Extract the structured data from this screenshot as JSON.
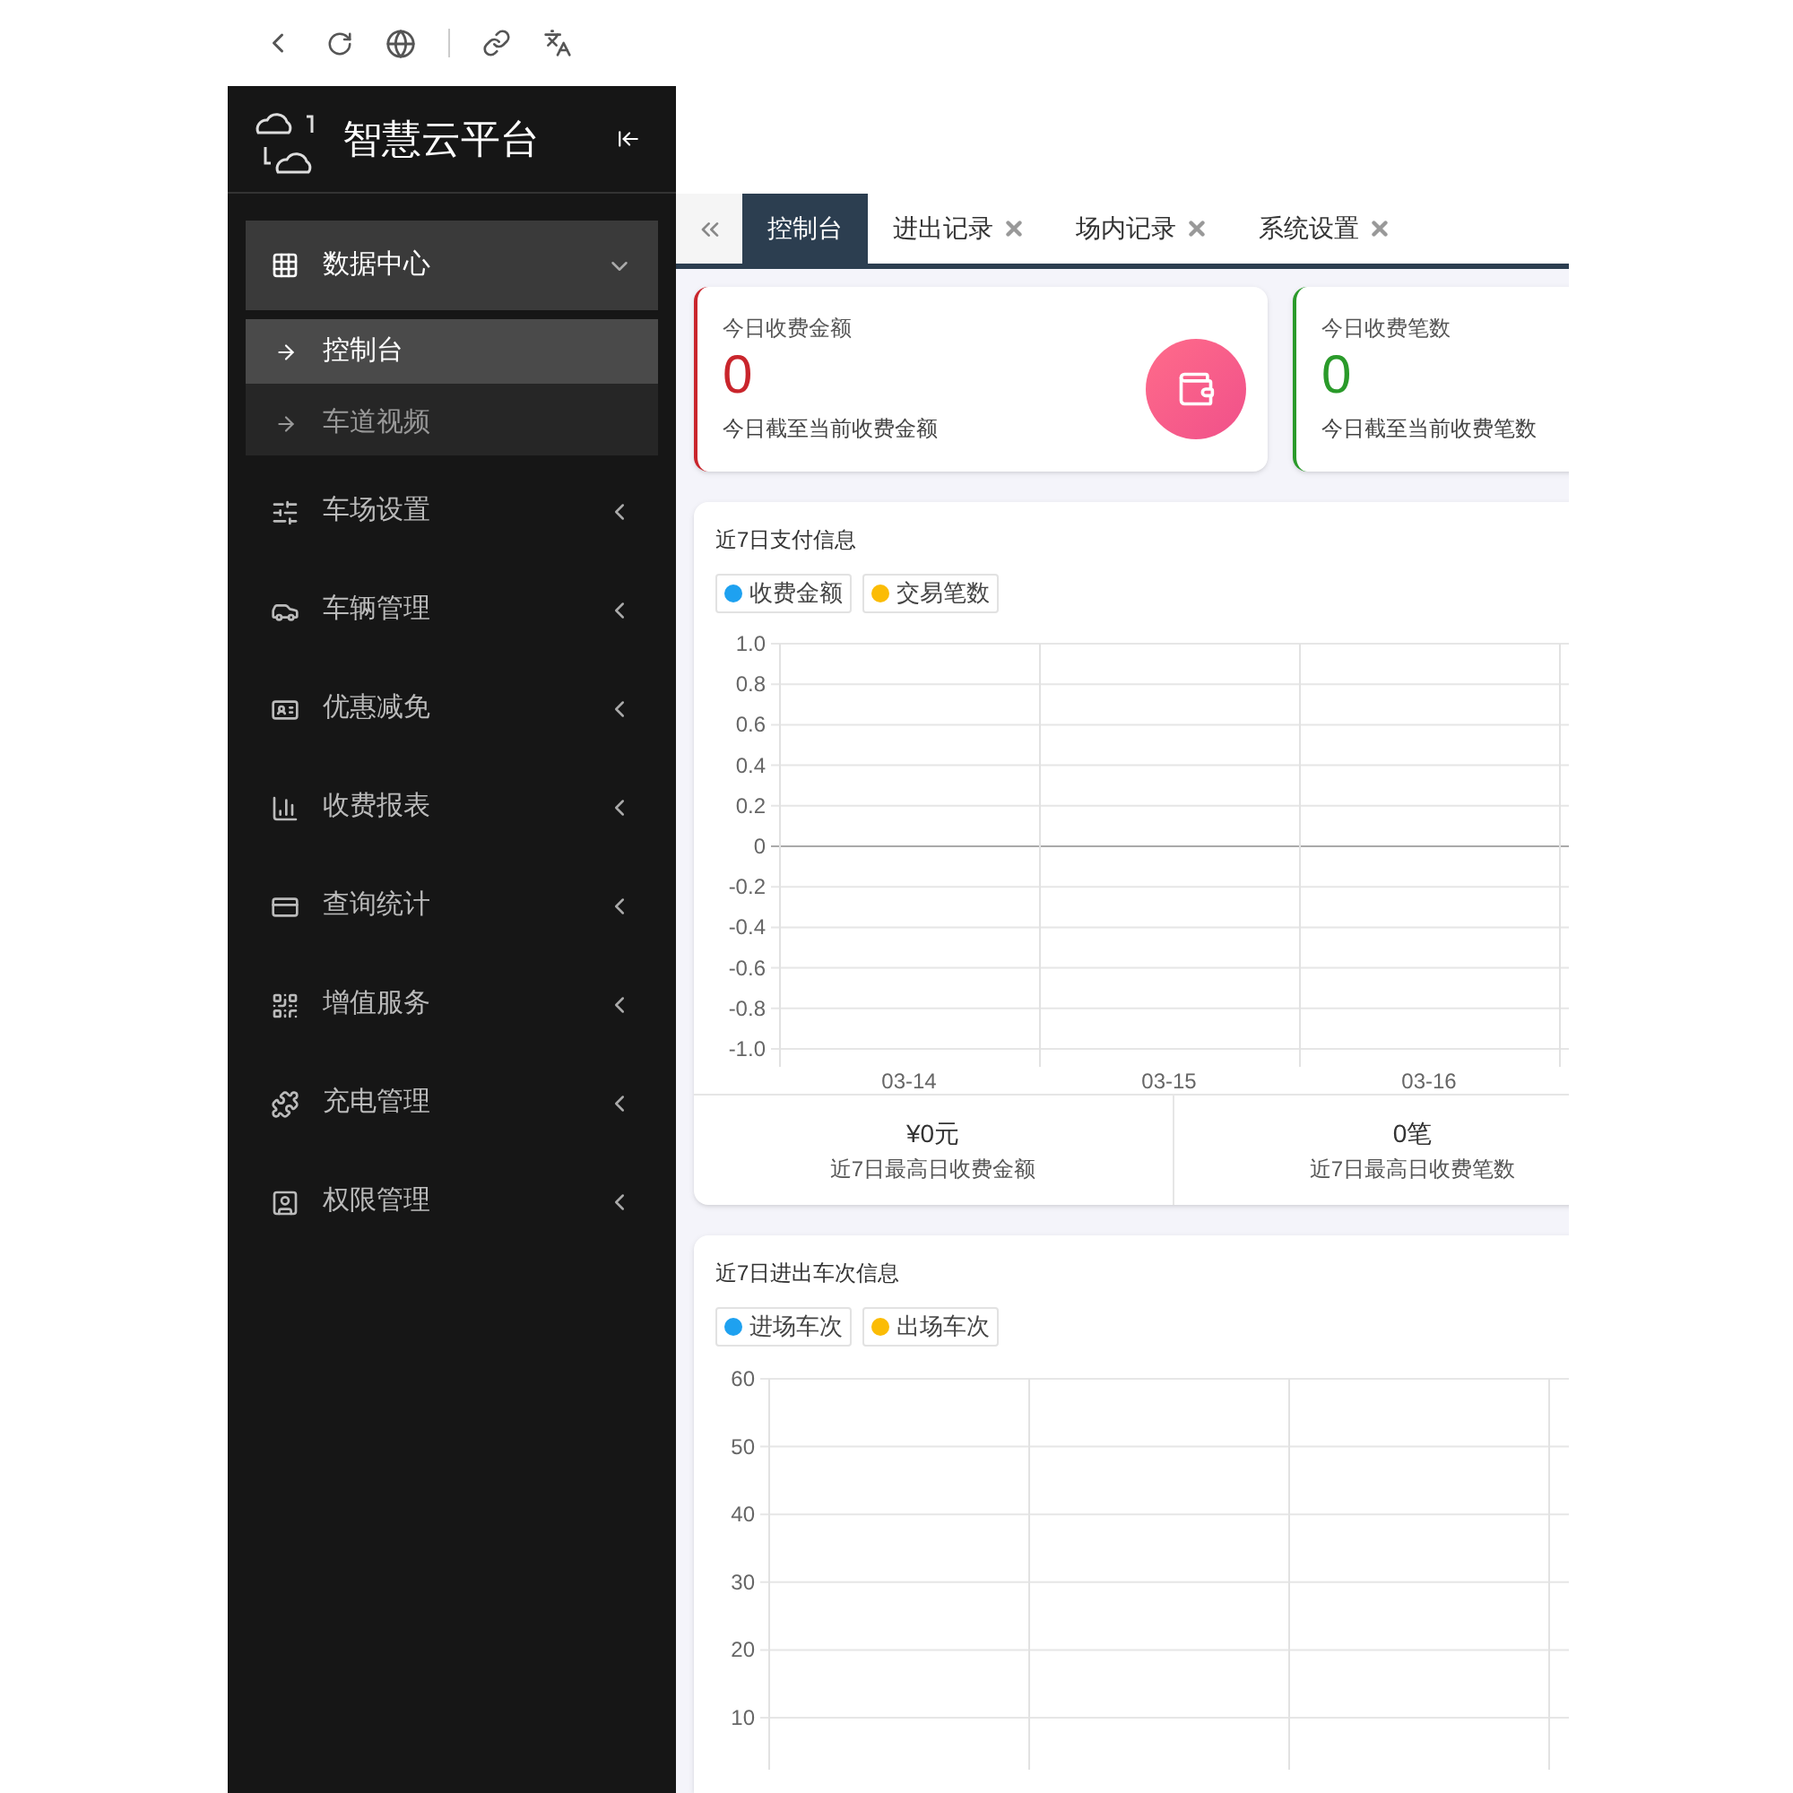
{
  "sidebar": {
    "title": "智慧云平台",
    "items": [
      {
        "label": "数据中心",
        "expanded": true,
        "children": [
          {
            "label": "控制台",
            "selected": true
          },
          {
            "label": "车道视频",
            "selected": false
          }
        ]
      },
      {
        "label": "车场设置",
        "expanded": false
      },
      {
        "label": "车辆管理",
        "expanded": false
      },
      {
        "label": "优惠减免",
        "expanded": false
      },
      {
        "label": "收费报表",
        "expanded": false
      },
      {
        "label": "查询统计",
        "expanded": false
      },
      {
        "label": "增值服务",
        "expanded": false
      },
      {
        "label": "充电管理",
        "expanded": false
      },
      {
        "label": "权限管理",
        "expanded": false
      }
    ]
  },
  "tabs": [
    {
      "label": "控制台",
      "selected": true,
      "closable": false
    },
    {
      "label": "进出记录",
      "selected": false,
      "closable": true
    },
    {
      "label": "场内记录",
      "selected": false,
      "closable": true
    },
    {
      "label": "系统设置",
      "selected": false,
      "closable": true
    }
  ],
  "stat_cards": [
    {
      "label": "今日收费金额",
      "value": "0",
      "caption": "今日截至当前收费金额",
      "color": "#c9252c"
    },
    {
      "label": "今日收费笔数",
      "value": "0",
      "caption": "今日截至当前收费笔数",
      "color": "#2a9a2a"
    }
  ],
  "payment_panel": {
    "title": "近7日支付信息",
    "chart_data": {
      "type": "line",
      "categories": [
        "03-14",
        "03-15",
        "03-16"
      ],
      "ylim": [
        -1,
        1
      ],
      "grid": true,
      "yticks": [
        {
          "value": 1,
          "label": "1.0"
        },
        0.8,
        0.6,
        0.4,
        0.2,
        0,
        -0.2,
        -0.4,
        -0.6,
        -0.8,
        {
          "value": -1,
          "label": "-1.0"
        }
      ],
      "series": [
        {
          "name": "收费金额",
          "color": "#1ea1f0",
          "values": [
            null,
            null,
            null
          ]
        },
        {
          "name": "交易笔数",
          "color": "#fbbc05",
          "values": [
            null,
            null,
            null
          ]
        }
      ]
    },
    "summary": [
      {
        "value": "¥0元",
        "label": "近7日最高日收费金额"
      },
      {
        "value": "0笔",
        "label": "近7日最高日收费笔数"
      }
    ]
  },
  "traffic_panel": {
    "title": "近7日进出车次信息",
    "chart_data": {
      "type": "line",
      "ylim": [
        10,
        60
      ],
      "grid": true,
      "yticks": [
        60,
        50,
        40,
        30,
        20,
        10
      ],
      "series": [
        {
          "name": "进场车次",
          "color": "#1ea1f0"
        },
        {
          "name": "出场车次",
          "color": "#fbbc05"
        }
      ]
    }
  }
}
